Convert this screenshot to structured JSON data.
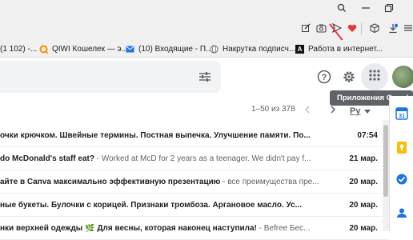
{
  "window": {
    "controls": [
      "search",
      "minimize",
      "restore"
    ]
  },
  "toolbar": {
    "icons": [
      "edit-icon",
      "camera-icon",
      "send-icon",
      "heart-icon",
      "cube-icon",
      "download-icon",
      "menu-icon"
    ]
  },
  "bookmarks": [
    {
      "label": "(1 102) -...",
      "icon": "mail-icon"
    },
    {
      "label": "QIWI Кошелек — э...",
      "icon": "qiwi-icon",
      "color": "#ff8c00"
    },
    {
      "label": "(10) Входящие - П...",
      "icon": "mail-icon",
      "color": "#1a73e8"
    },
    {
      "label": "Накрутка подписч...",
      "icon": "globe-icon"
    },
    {
      "label": "Работа в интернет...",
      "icon": "letter-a-icon"
    }
  ],
  "header": {
    "apps_tooltip": "Приложения Google"
  },
  "pager": {
    "range": "1–50 из 378",
    "lang": "Ру"
  },
  "rows": [
    {
      "subject": "очки крючком. Швейные термины. Постная выпечка. Улучшение памяти. По...",
      "snippet": "",
      "date": "07:54"
    },
    {
      "subject": "do McDonald's staff eat?",
      "snippet": " - Worked at McD for 2 years as a teenager. We didn't pay f...",
      "date": "21 мар."
    },
    {
      "subject": "айте в Canva максимально эффективную презентацию",
      "snippet": " - все преимущества пре...",
      "date": "20 мар."
    },
    {
      "subject": "ные букеты. Булочки с корицей. Признаки тромбоза. Аргановое масло. Ус...",
      "snippet": "",
      "date": "20 мар."
    },
    {
      "subject": "нки верхней одежды 🌿 Для весны, которая наконец наступила!",
      "snippet": " - Befree Бес...",
      "date": "20 мар."
    }
  ],
  "colors": {
    "accent_red": "#e53935",
    "avatar": "#6b8e5a"
  }
}
